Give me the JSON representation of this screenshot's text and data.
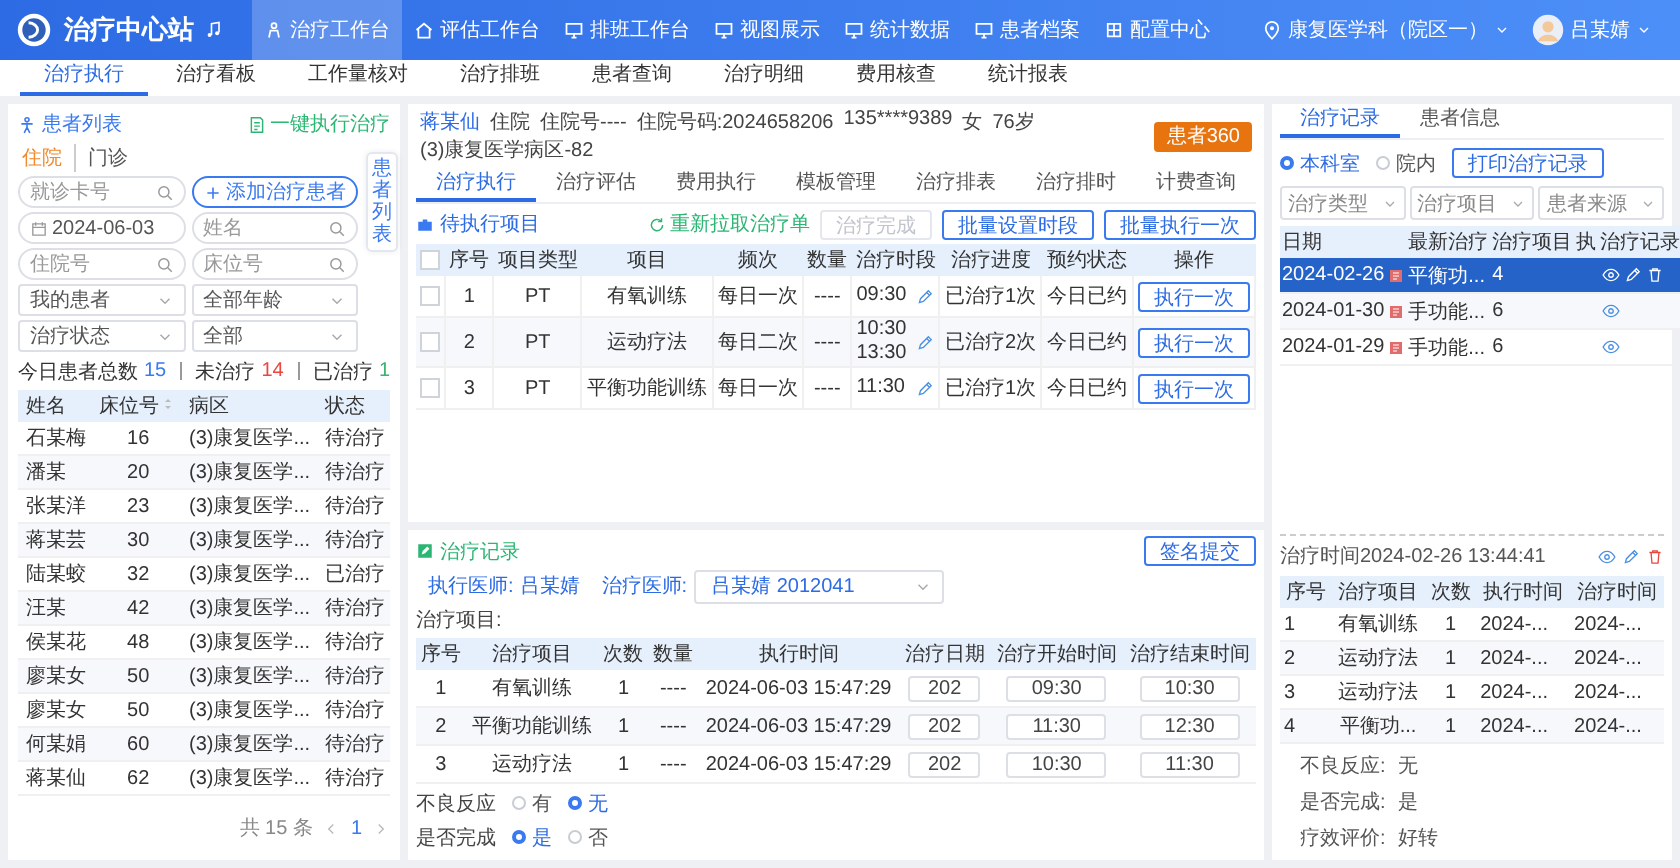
{
  "header": {
    "title": "治疗中心站",
    "nav": [
      {
        "label": "治疗工作台",
        "selected": true
      },
      {
        "label": "评估工作台",
        "selected": false
      },
      {
        "label": "排班工作台",
        "selected": false
      },
      {
        "label": "视图展示",
        "selected": false
      },
      {
        "label": "统计数据",
        "selected": false
      },
      {
        "label": "患者档案",
        "selected": false
      },
      {
        "label": "配置中心",
        "selected": false
      }
    ],
    "department": "康复医学科（院区一）",
    "user": "吕某婧"
  },
  "subtabs": [
    {
      "label": "治疗执行",
      "selected": true
    },
    {
      "label": "治疗看板",
      "selected": false
    },
    {
      "label": "工作量核对",
      "selected": false
    },
    {
      "label": "治疗排班",
      "selected": false
    },
    {
      "label": "患者查询",
      "selected": false
    },
    {
      "label": "治疗明细",
      "selected": false
    },
    {
      "label": "费用核查",
      "selected": false
    },
    {
      "label": "统计报表",
      "selected": false
    }
  ],
  "patient_list": {
    "title": "患者列表",
    "execute_all": "一键执行治疗",
    "side_tab": "患者列表",
    "tabs": [
      {
        "label": "住院",
        "selected": true
      },
      {
        "label": "门诊",
        "selected": false
      }
    ],
    "fields": [
      {
        "kind": "search",
        "placeholder": "就诊卡号"
      },
      {
        "kind": "button",
        "label": "添加治疗患者"
      },
      {
        "kind": "date",
        "value": "2024-06-03"
      },
      {
        "kind": "search",
        "placeholder": "姓名"
      },
      {
        "kind": "search",
        "placeholder": "住院号"
      },
      {
        "kind": "search",
        "placeholder": "床位号"
      },
      {
        "kind": "select",
        "value": "我的患者"
      },
      {
        "kind": "select",
        "value": "全部年龄"
      },
      {
        "kind": "select",
        "value": "治疗状态"
      },
      {
        "kind": "select",
        "value": "全部"
      }
    ],
    "stats": [
      {
        "label": "今日患者总数",
        "count": "15",
        "color": "#3a7af0"
      },
      {
        "label": "未治疗",
        "count": "14",
        "color": "#e8483f"
      },
      {
        "label": "已治疗",
        "count": "1",
        "color": "#3cb371"
      }
    ],
    "columns": [
      {
        "label": "姓名",
        "sortable": false
      },
      {
        "label": "床位号",
        "sortable": true
      },
      {
        "label": "病区",
        "sortable": false
      },
      {
        "label": "状态",
        "sortable": false
      }
    ],
    "rows": [
      {
        "name": "石某梅",
        "bed": "16",
        "ward": "(3)康复医学...",
        "status": "待治疗"
      },
      {
        "name": "潘某",
        "bed": "20",
        "ward": "(3)康复医学...",
        "status": "待治疗"
      },
      {
        "name": "张某洋",
        "bed": "23",
        "ward": "(3)康复医学...",
        "status": "待治疗"
      },
      {
        "name": "蒋某芸",
        "bed": "30",
        "ward": "(3)康复医学...",
        "status": "待治疗"
      },
      {
        "name": "陆某蛟",
        "bed": "32",
        "ward": "(3)康复医学...",
        "status": "已治疗"
      },
      {
        "name": "汪某",
        "bed": "42",
        "ward": "(3)康复医学...",
        "status": "待治疗"
      },
      {
        "name": "侯某花",
        "bed": "48",
        "ward": "(3)康复医学...",
        "status": "待治疗"
      },
      {
        "name": "廖某女",
        "bed": "50",
        "ward": "(3)康复医学...",
        "status": "待治疗"
      },
      {
        "name": "廖某女",
        "bed": "50",
        "ward": "(3)康复医学...",
        "status": "待治疗"
      },
      {
        "name": "何某娟",
        "bed": "60",
        "ward": "(3)康复医学...",
        "status": "待治疗"
      },
      {
        "name": "蒋某仙",
        "bed": "62",
        "ward": "(3)康复医学...",
        "status": "待治疗"
      }
    ],
    "pagination": {
      "total": "共 15 条",
      "page": "1"
    }
  },
  "treatment": {
    "info": [
      "蒋某仙",
      "住院",
      "住院号----",
      "住院号码:2024658206",
      "135****9389",
      "女",
      "76岁",
      "(3)康复医学病区-82"
    ],
    "patient360": "患者360",
    "tabs": [
      {
        "label": "治疗执行",
        "selected": true
      },
      {
        "label": "治疗评估",
        "selected": false
      },
      {
        "label": "费用执行",
        "selected": false
      },
      {
        "label": "模板管理",
        "selected": false
      },
      {
        "label": "治疗排表",
        "selected": false
      },
      {
        "label": "治疗排时",
        "selected": false
      },
      {
        "label": "计费查询",
        "selected": false
      }
    ],
    "pending_title": "待执行项目",
    "refetch": "重新拉取治疗单",
    "actions": [
      {
        "label": "治疗完成",
        "disabled": true
      },
      {
        "label": "批量设置时段",
        "disabled": false
      },
      {
        "label": "批量执行一次",
        "disabled": false
      }
    ],
    "select_all_checked": false,
    "columns": [
      "序号",
      "项目类型",
      "项目",
      "频次",
      "数量",
      "治疗时段",
      "治疗进度",
      "预约状态",
      "操作"
    ],
    "rows": [
      {
        "checked": false,
        "no": "1",
        "type": "PT",
        "item": "有氧训练",
        "freq": "每日一次",
        "qty": "----",
        "times": [
          "09:30"
        ],
        "progress": "已治疗1次",
        "booking": "今日已约",
        "action": "执行一次"
      },
      {
        "checked": false,
        "no": "2",
        "type": "PT",
        "item": "运动疗法",
        "freq": "每日二次",
        "qty": "----",
        "times": [
          "10:30",
          "13:30"
        ],
        "progress": "已治疗2次",
        "booking": "今日已约",
        "action": "执行一次"
      },
      {
        "checked": false,
        "no": "3",
        "type": "PT",
        "item": "平衡功能训练",
        "freq": "每日一次",
        "qty": "----",
        "times": [
          "11:30"
        ],
        "progress": "已治疗1次",
        "booking": "今日已约",
        "action": "执行一次"
      }
    ]
  },
  "record": {
    "title": "治疗记录",
    "submit": "签名提交",
    "exec_label": "执行医师:",
    "exec_doctor": "吕某婧",
    "doctor_label": "治疗医师:",
    "doctor": "吕某婧 2012041",
    "items_label": "治疗项目:",
    "columns": [
      "序号",
      "治疗项目",
      "次数",
      "数量",
      "执行时间",
      "治疗日期",
      "治疗开始时间",
      "治疗结束时间"
    ],
    "rows": [
      {
        "no": "1",
        "item": "有氧训练",
        "count": "1",
        "qty": "----",
        "time": "2024-06-03  15:47:29",
        "date": "202",
        "start": "09:30",
        "end": "10:30"
      },
      {
        "no": "2",
        "item": "平衡功能训练",
        "count": "1",
        "qty": "----",
        "time": "2024-06-03  15:47:29",
        "date": "202",
        "start": "11:30",
        "end": "12:30"
      },
      {
        "no": "3",
        "item": "运动疗法",
        "count": "1",
        "qty": "----",
        "time": "2024-06-03  15:47:29",
        "date": "202",
        "start": "10:30",
        "end": "11:30"
      }
    ],
    "questions": [
      {
        "label": "不良反应",
        "options": [
          {
            "label": "有",
            "selected": false
          },
          {
            "label": "无",
            "selected": true
          }
        ]
      },
      {
        "label": "是否完成",
        "options": [
          {
            "label": "是",
            "selected": true
          },
          {
            "label": "否",
            "selected": false
          }
        ]
      }
    ]
  },
  "history": {
    "tabs": [
      {
        "label": "治疗记录",
        "selected": true
      },
      {
        "label": "患者信息",
        "selected": false
      }
    ],
    "scope": [
      {
        "label": "本科室",
        "selected": true
      },
      {
        "label": "院内",
        "selected": false
      }
    ],
    "print": "打印治疗记录",
    "filters": [
      "治疗类型",
      "治疗项目",
      "患者来源"
    ],
    "columns": [
      "日期",
      "最新治疗",
      "治疗项目",
      "执",
      "治疗记录"
    ],
    "rows": [
      {
        "date": "2024-02-26",
        "latest": "平衡功...",
        "count": "4",
        "editable": true,
        "selected": true
      },
      {
        "date": "2024-01-30",
        "latest": "手功能...",
        "count": "6",
        "editable": false,
        "selected": false
      },
      {
        "date": "2024-01-29",
        "latest": "手功能...",
        "count": "6",
        "editable": false,
        "selected": false
      }
    ],
    "detail": {
      "time": "治疗时间2024-02-26 13:44:41",
      "columns": [
        "序号",
        "治疗项目",
        "次数",
        "执行时间",
        "治疗时间"
      ],
      "rows": [
        [
          "1",
          "有氧训练",
          "1",
          "2024-...",
          "2024-..."
        ],
        [
          "2",
          "运动疗法",
          "1",
          "2024-...",
          "2024-..."
        ],
        [
          "3",
          "运动疗法",
          "1",
          "2024-...",
          "2024-..."
        ],
        [
          "4",
          "平衡功...",
          "1",
          "2024-...",
          "2024-..."
        ]
      ],
      "fields": [
        {
          "label": "不良反应:",
          "value": "无"
        },
        {
          "label": "是否完成:",
          "value": "是"
        },
        {
          "label": "疗效评价:",
          "value": "好转"
        }
      ]
    }
  }
}
